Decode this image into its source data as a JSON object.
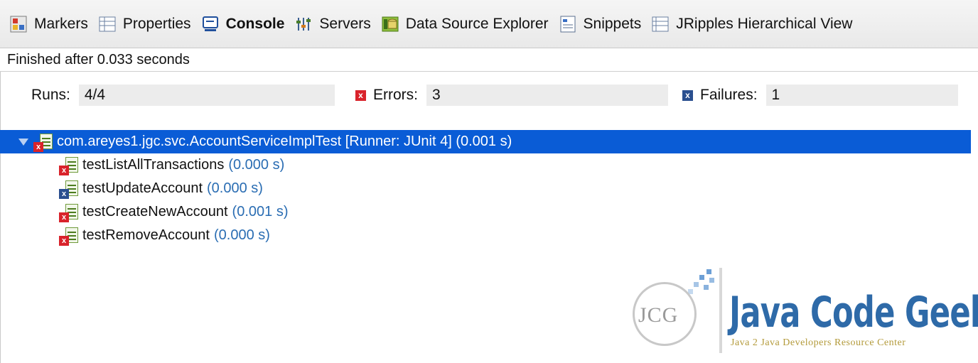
{
  "tabs": [
    {
      "label": "Markers",
      "icon": "markers-icon",
      "active": false
    },
    {
      "label": "Properties",
      "icon": "properties-icon",
      "active": false
    },
    {
      "label": "Console",
      "icon": "console-icon",
      "active": true
    },
    {
      "label": "Servers",
      "icon": "servers-icon",
      "active": false
    },
    {
      "label": "Data Source Explorer",
      "icon": "data-source-explorer-icon",
      "active": false
    },
    {
      "label": "Snippets",
      "icon": "snippets-icon",
      "active": false
    },
    {
      "label": "JRipples Hierarchical View",
      "icon": "jripples-icon",
      "active": false
    }
  ],
  "status": {
    "text": "Finished after 0.033 seconds"
  },
  "counters": {
    "runs_label": "Runs:",
    "runs_value": "4/4",
    "errors_label": "Errors:",
    "errors_value": "3",
    "failures_label": "Failures:",
    "failures_value": "1"
  },
  "tree": {
    "root": {
      "label": "com.areyes1.jgc.svc.AccountServiceImplTest [Runner: JUnit 4] (0.001 s)"
    },
    "tests": [
      {
        "name": "testListAllTransactions",
        "time": "(0.000 s)",
        "result": "error"
      },
      {
        "name": "testUpdateAccount",
        "time": "(0.000 s)",
        "result": "failure"
      },
      {
        "name": "testCreateNewAccount",
        "time": "(0.001 s)",
        "result": "error"
      },
      {
        "name": "testRemoveAccount",
        "time": "(0.000 s)",
        "result": "error"
      }
    ]
  },
  "watermark": {
    "logo_mark": "JCG",
    "title": "Java Code Geeks",
    "subtitle": "Java 2 Java Developers Resource Center"
  },
  "colors": {
    "selection": "#0a5cd6",
    "error": "#d9232b",
    "failure": "#2a4f8f",
    "time": "#2a6db3"
  }
}
